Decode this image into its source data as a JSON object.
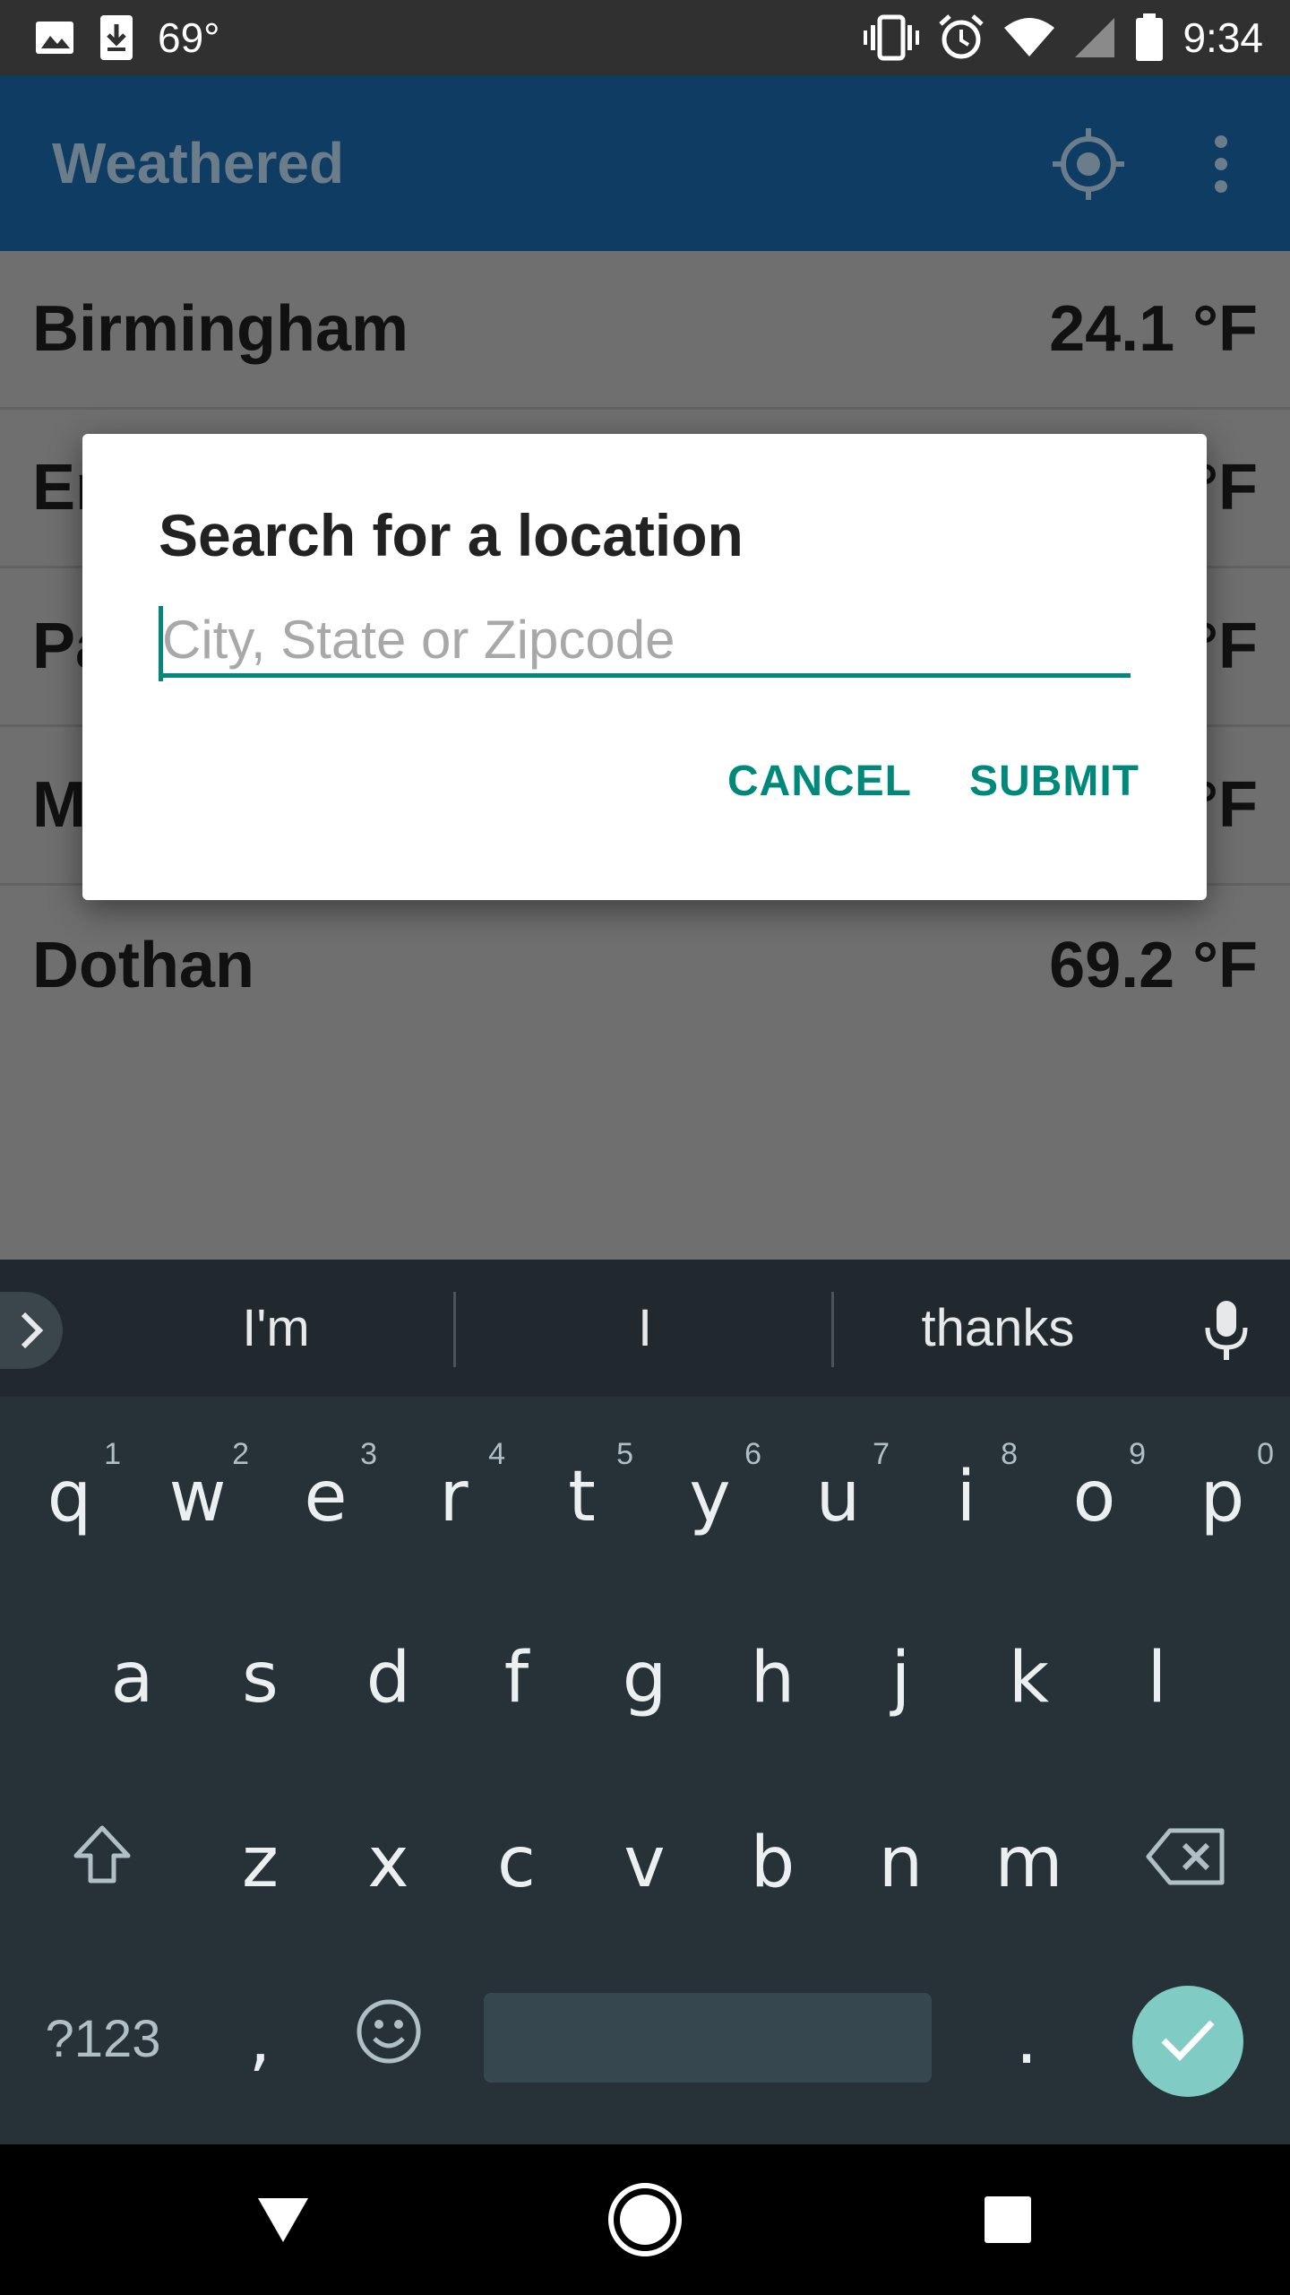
{
  "status_bar": {
    "temperature": "69°",
    "time": "9:34",
    "icons": [
      "image-icon",
      "download-icon",
      "vibrate-icon",
      "alarm-icon",
      "wifi-icon",
      "cell-signal-icon",
      "battery-icon"
    ]
  },
  "app_bar": {
    "title": "Weathered",
    "actions": [
      "location-target-icon",
      "overflow-menu-icon"
    ]
  },
  "locations": [
    {
      "city": "Birmingham",
      "temp": "24.1 °F"
    },
    {
      "city": "En",
      "temp": "°F"
    },
    {
      "city": "Pa",
      "temp": "°F"
    },
    {
      "city": "M",
      "temp": "°F"
    },
    {
      "city": "Dothan",
      "temp": "69.2 °F"
    }
  ],
  "dialog": {
    "title": "Search for a location",
    "input_value": "",
    "input_placeholder": "City, State or Zipcode",
    "cancel_label": "CANCEL",
    "submit_label": "SUBMIT"
  },
  "keyboard": {
    "suggestions": [
      "I'm",
      "I",
      "thanks"
    ],
    "row1": [
      {
        "key": "q",
        "hint": "1"
      },
      {
        "key": "w",
        "hint": "2"
      },
      {
        "key": "e",
        "hint": "3"
      },
      {
        "key": "r",
        "hint": "4"
      },
      {
        "key": "t",
        "hint": "5"
      },
      {
        "key": "y",
        "hint": "6"
      },
      {
        "key": "u",
        "hint": "7"
      },
      {
        "key": "i",
        "hint": "8"
      },
      {
        "key": "o",
        "hint": "9"
      },
      {
        "key": "p",
        "hint": "0"
      }
    ],
    "row2": [
      "a",
      "s",
      "d",
      "f",
      "g",
      "h",
      "j",
      "k",
      "l"
    ],
    "row3": [
      "z",
      "x",
      "c",
      "v",
      "b",
      "n",
      "m"
    ],
    "symbols_label": "?123",
    "comma_label": ",",
    "period_label": ".",
    "colors": {
      "background": "#263238",
      "enter": "#80cbc4",
      "accent": "#00897b"
    }
  },
  "nav_bar": {
    "icons": [
      "back-icon",
      "home-icon",
      "recents-icon"
    ]
  }
}
